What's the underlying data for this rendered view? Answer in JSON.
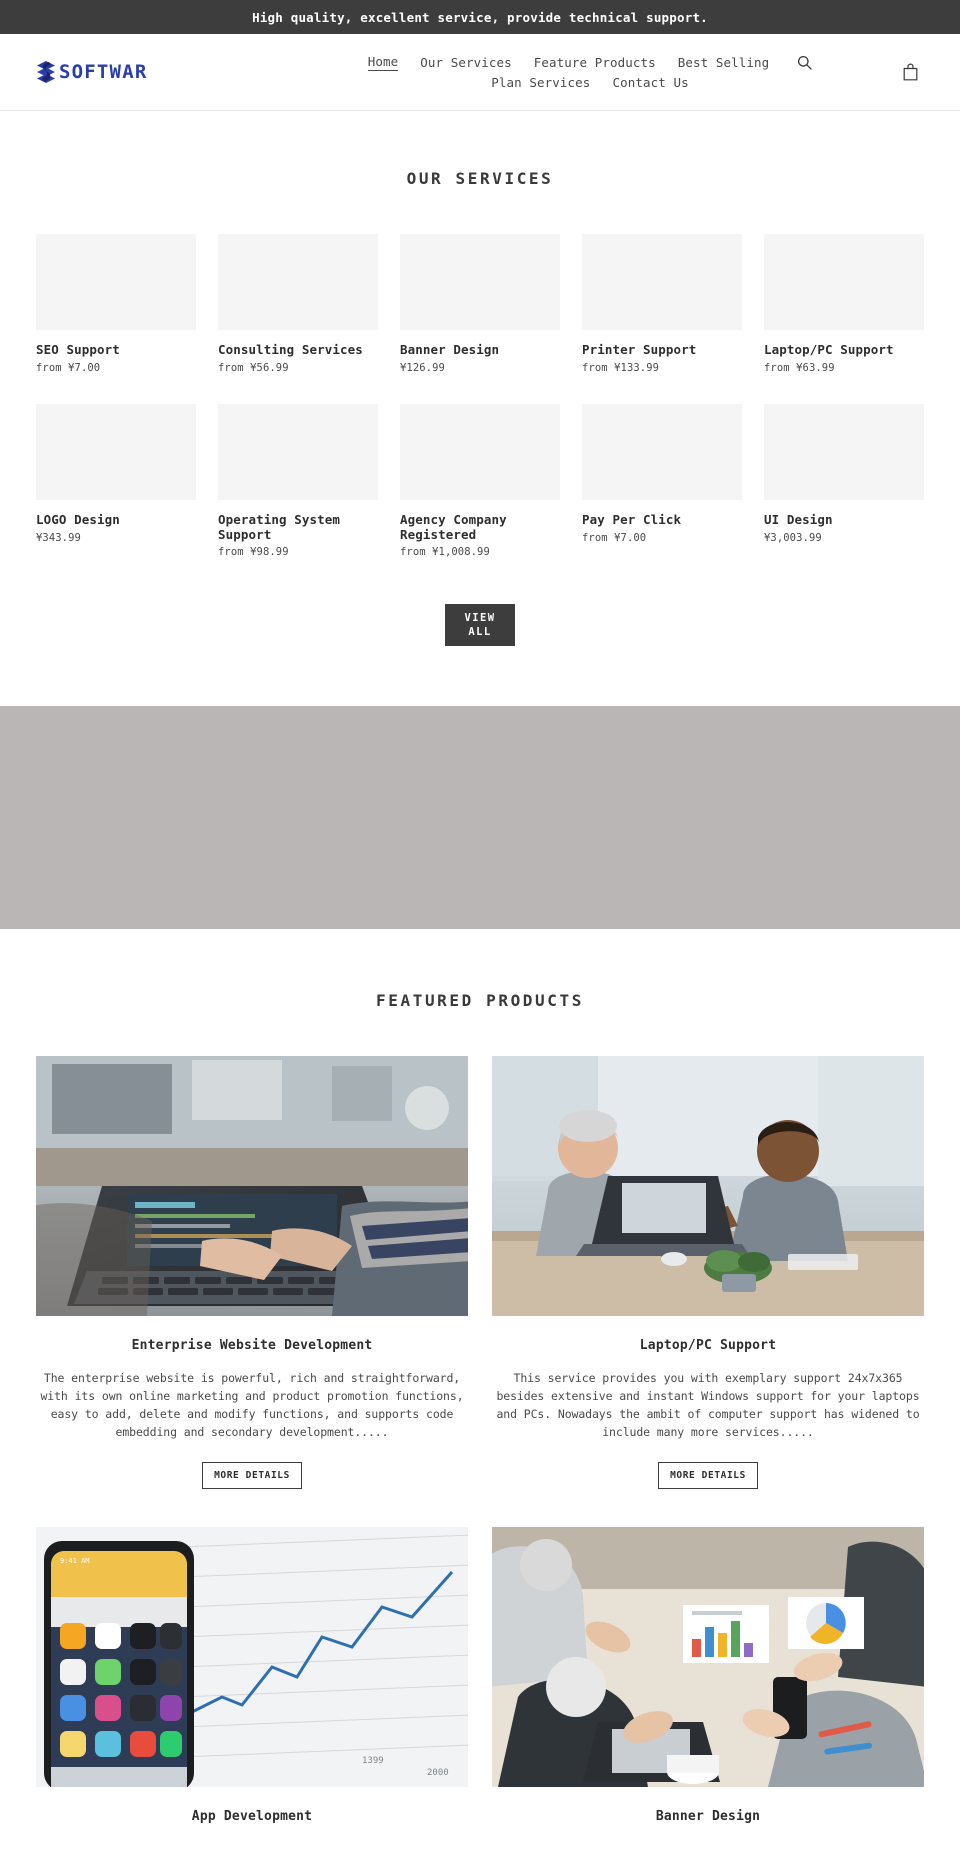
{
  "announcement": {
    "text": "High quality, excellent service, provide technical support."
  },
  "header": {
    "logo_text": "SOFTWAR",
    "nav_row1": [
      {
        "label": "Home",
        "active": true
      },
      {
        "label": "Our Services",
        "active": false
      },
      {
        "label": "Feature Products",
        "active": false
      },
      {
        "label": "Best Selling",
        "active": false
      }
    ],
    "nav_row2": [
      {
        "label": "Plan Services",
        "active": false
      },
      {
        "label": "Contact Us",
        "active": false
      }
    ],
    "search_icon": "search-icon",
    "cart_icon": "shopping-bag-icon"
  },
  "services": {
    "title": "OUR SERVICES",
    "items": [
      {
        "name": "SEO Support",
        "price": "from ¥7.00"
      },
      {
        "name": "Consulting Services",
        "price": "from ¥56.99"
      },
      {
        "name": "Banner Design",
        "price": "¥126.99"
      },
      {
        "name": "Printer Support",
        "price": "from ¥133.99"
      },
      {
        "name": "Laptop/PC Support",
        "price": "from ¥63.99"
      },
      {
        "name": "LOGO Design",
        "price": "¥343.99"
      },
      {
        "name": "Operating System Support",
        "price": "from ¥98.99"
      },
      {
        "name": "Agency Company Registered",
        "price": "from ¥1,008.99"
      },
      {
        "name": "Pay Per Click",
        "price": "from ¥7.00"
      },
      {
        "name": "UI Design",
        "price": "¥3,003.99"
      }
    ],
    "view_all_line1": "VIEW",
    "view_all_line2": "ALL"
  },
  "featured": {
    "title": "FEATURED PRODUCTS",
    "more_details_label": "MORE DETAILS",
    "items": [
      {
        "name": "Enterprise Website Development",
        "desc": "The enterprise website is powerful, rich and straightforward, with its own online marketing and product promotion functions, easy to add, delete and modify functions, and supports code embedding and secondary development.....",
        "image": "laptop-typing-photo"
      },
      {
        "name": "Laptop/PC Support",
        "desc": "This service provides you with exemplary support 24x7x365 besides extensive and instant Windows support for your laptops and PCs. Nowadays the ambit of computer support has widened to include many more services.....",
        "image": "two-men-laptop-photo"
      },
      {
        "name": "App Development",
        "desc": "",
        "image": "smartphone-chart-photo"
      },
      {
        "name": "Banner Design",
        "desc": "",
        "image": "team-desk-photo"
      }
    ]
  },
  "colors": {
    "announce_bg": "#3d3d3d",
    "logo_blue": "#2b3ea8",
    "thumb_placeholder": "#f5f5f5",
    "hero_banner": "#bab6b6",
    "button_dark": "#3d3d3d"
  }
}
